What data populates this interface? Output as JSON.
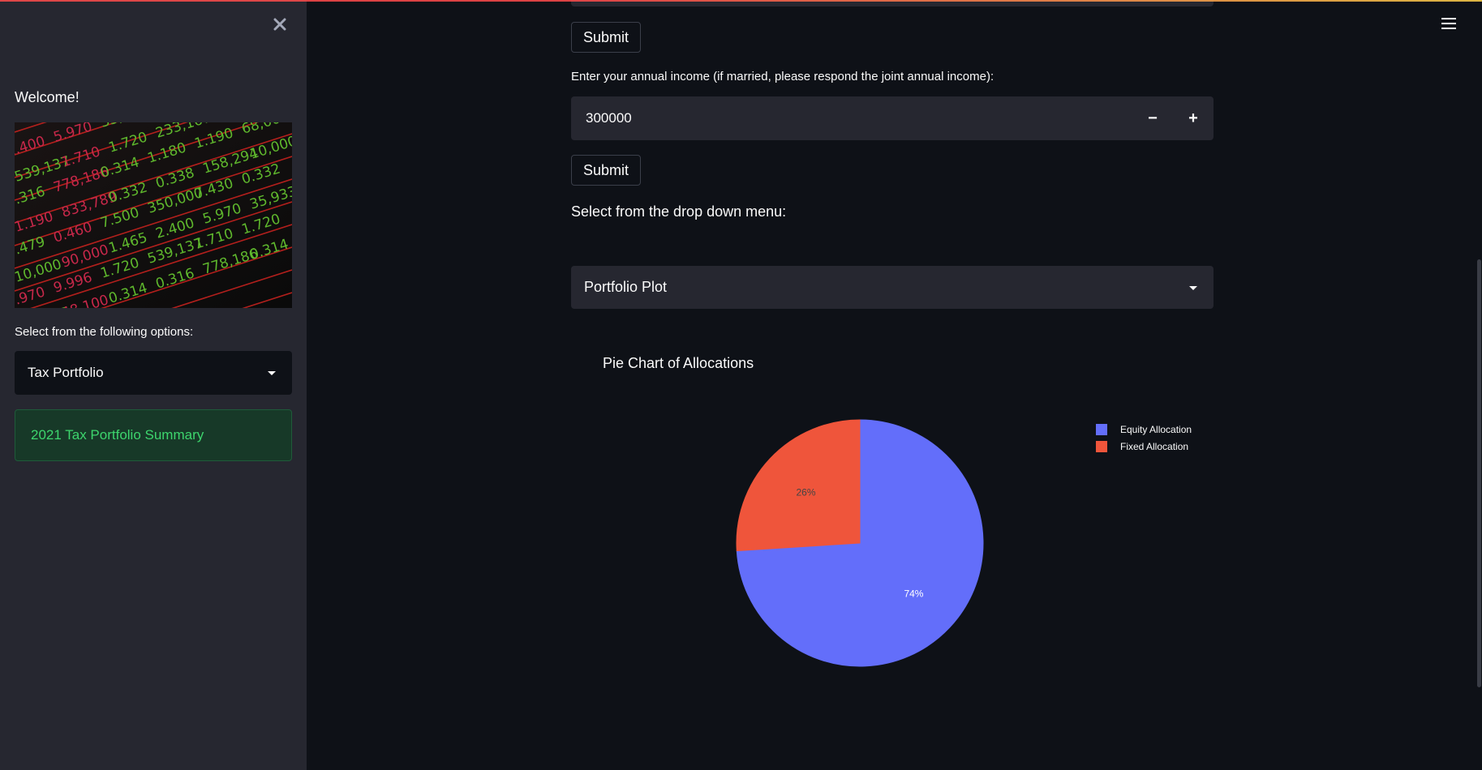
{
  "sidebar": {
    "welcome": "Welcome!",
    "options_label": "Select from the following options:",
    "selected_option": "Tax Portfolio",
    "summary_text": "2021 Tax Portfolio Summary",
    "image_numbers": [
      "2.400",
      "5.970",
      "35,933",
      "5.970",
      "9.996",
      "1.720",
      "539,137",
      "1.710",
      "1.720",
      "233,167",
      "48,100",
      "0.314",
      "0.316",
      "778,186",
      "0.314",
      "1.180",
      "1.190",
      "68,000",
      "1.190",
      "833,789",
      "0.332",
      "0.338",
      "158,294",
      "10,000",
      "0.479",
      "0.460",
      "7.500",
      "350,000",
      "7.430",
      "0.332",
      "10,000",
      "90,000",
      "1.465"
    ]
  },
  "main": {
    "submit_label": "Submit",
    "income_label": "Enter your annual income (if married, please respond the joint annual income):",
    "income_value": "300000",
    "decrement_symbol": "−",
    "increment_symbol": "+",
    "dropdown_label": "Select from the drop down menu:",
    "dropdown_selected": "Portfolio Plot"
  },
  "icons": {
    "close": "close-icon",
    "menu": "hamburger-menu-icon",
    "caret": "chevron-down-icon"
  },
  "colors": {
    "equity": "#636efa",
    "fixed": "#ef553b",
    "success_text": "#3dd56d"
  },
  "chart_data": {
    "type": "pie",
    "title": "Pie Chart of Allocations",
    "categories": [
      "Equity Allocation",
      "Fixed Allocation"
    ],
    "values": [
      74,
      26
    ],
    "labels": [
      "74%",
      "26%"
    ],
    "colors": [
      "#636efa",
      "#ef553b"
    ],
    "legend": "top-right"
  }
}
